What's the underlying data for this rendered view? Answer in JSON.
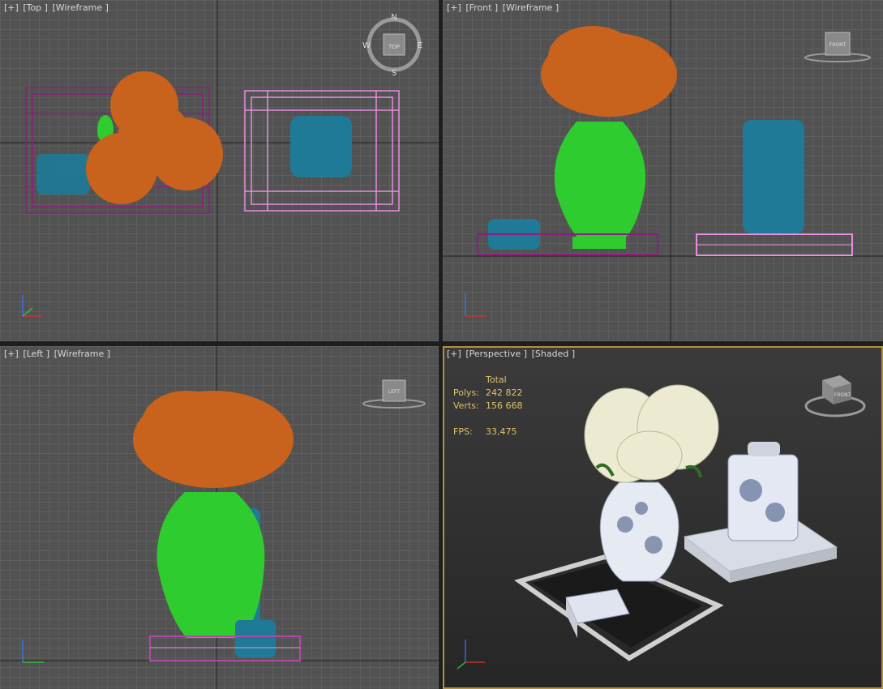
{
  "viewports": [
    {
      "id": "top",
      "labels": [
        "[+]",
        "[Top ]",
        "[Wireframe ]"
      ],
      "nav_label": "TOP",
      "compass": [
        "N",
        "S",
        "E",
        "W"
      ]
    },
    {
      "id": "front",
      "labels": [
        "[+]",
        "[Front ]",
        "[Wireframe ]"
      ],
      "nav_label": "FRONT"
    },
    {
      "id": "left",
      "labels": [
        "[+]",
        "[Left ]",
        "[Wireframe ]"
      ],
      "nav_label": "LEFT"
    },
    {
      "id": "perspective",
      "labels": [
        "[+]",
        "[Perspective ]",
        "[Shaded ]"
      ],
      "nav_label": "FRONT",
      "active": true,
      "stats": {
        "header": "Total",
        "polys_label": "Polys:",
        "polys": "242 822",
        "verts_label": "Verts:",
        "verts": "156 668",
        "fps_label": "FPS:",
        "fps": "33,475"
      }
    }
  ],
  "axes": {
    "x": "x",
    "y": "y",
    "z": "z"
  },
  "colors": {
    "active_border": "#b38e3c",
    "flowers": "#c8621c",
    "vase": "#2ecc2e",
    "tray": "#8c1e7a",
    "jar": "#1e7a96",
    "book": "#e88ee0",
    "stats_text": "#e0c36a"
  }
}
